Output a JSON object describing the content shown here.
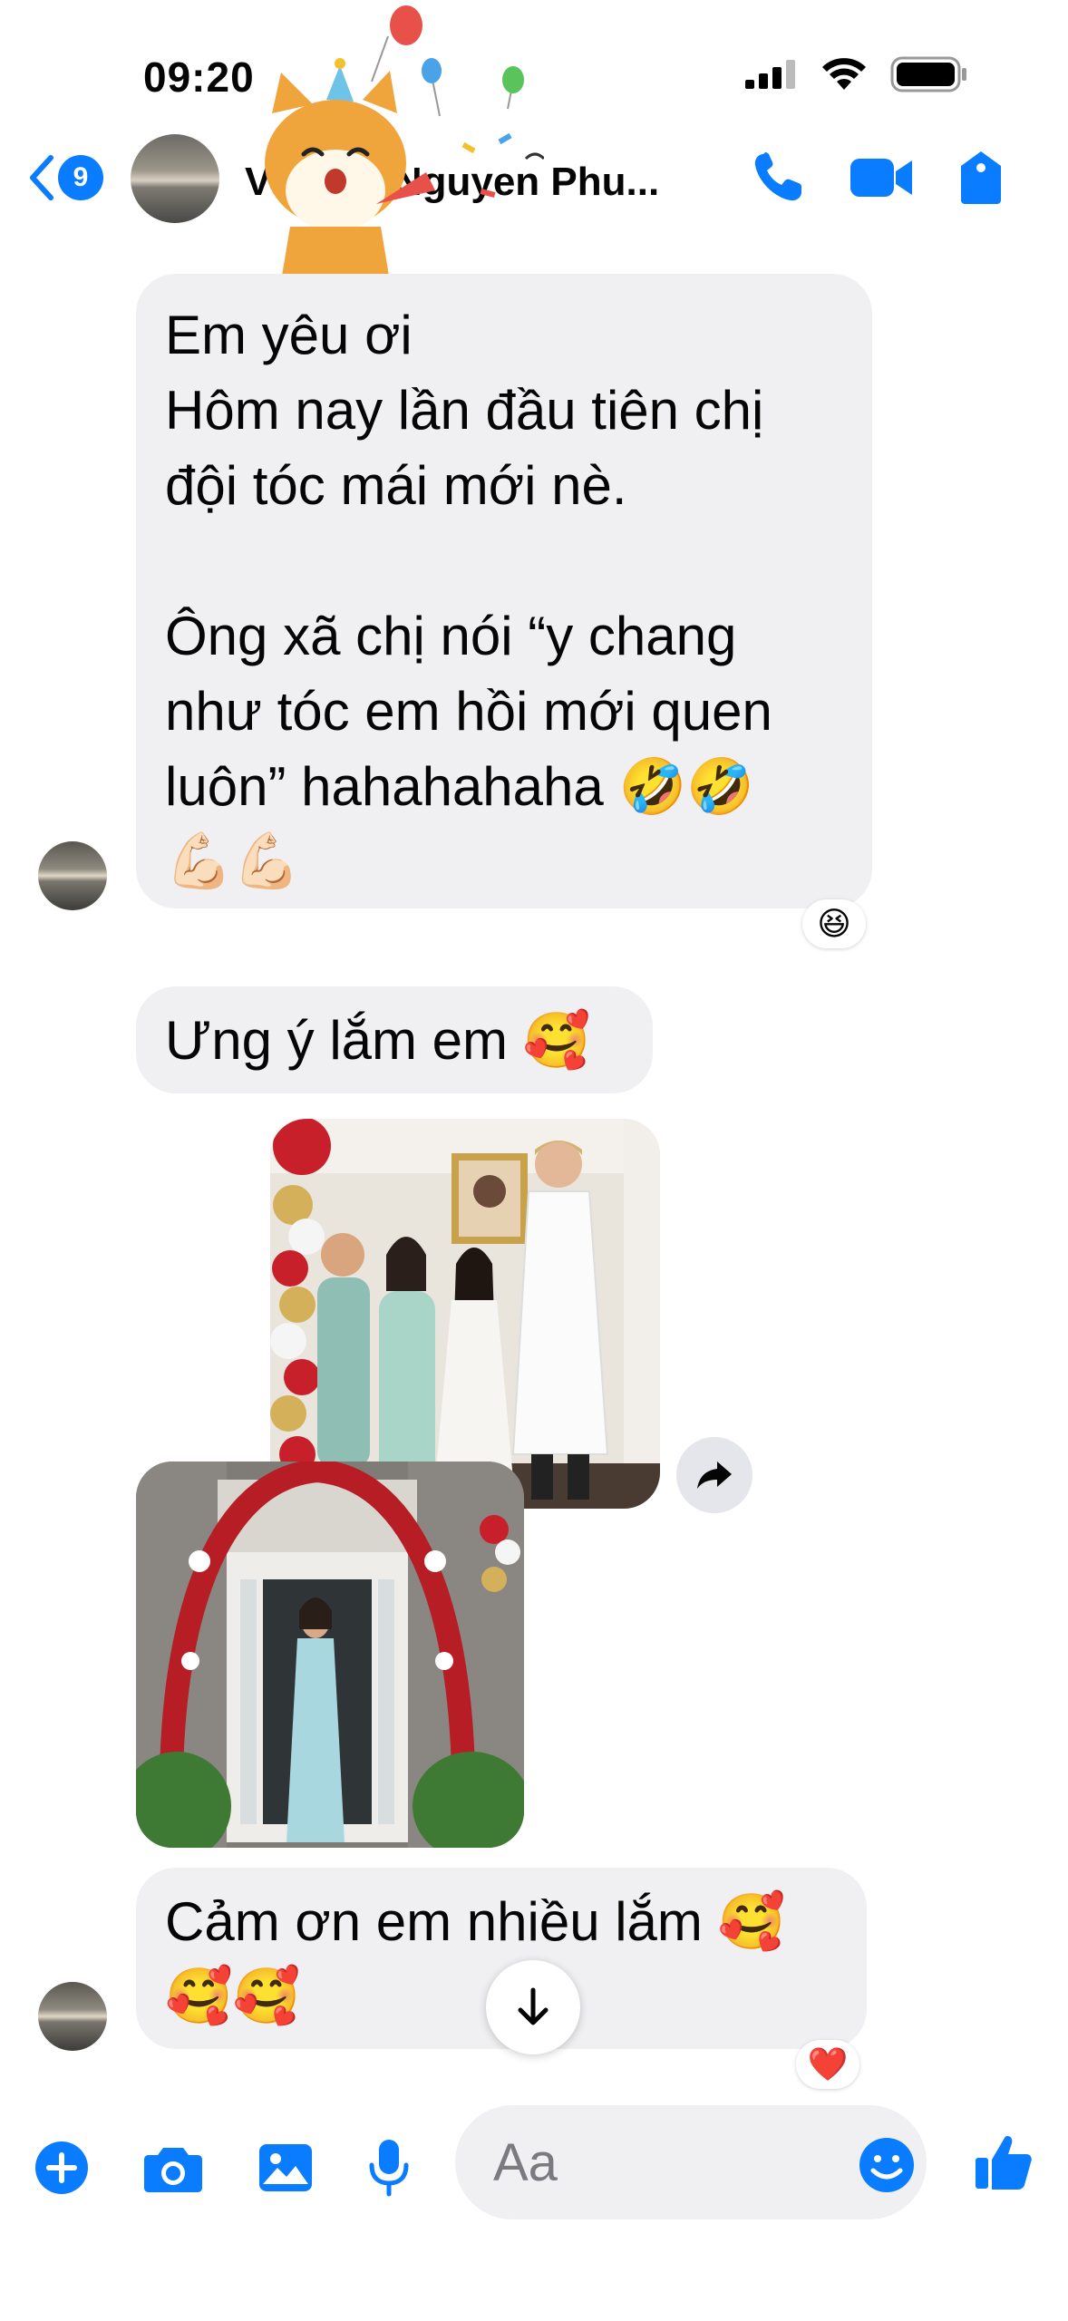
{
  "status_bar": {
    "time": "09:20"
  },
  "header": {
    "back_count": "9",
    "contact_name": "Nguyen Phu...",
    "name_prefix": "V"
  },
  "messages": [
    {
      "type": "text",
      "lines": [
        "Em yêu ơi",
        "Hôm nay lần đầu tiên chị",
        "đội tóc mái mới nè.",
        "",
        "Ông xã chị nói “y chang",
        "như tóc em hồi mới quen",
        "luôn” hahahahaha 🤣🤣",
        "💪🏻💪🏻"
      ],
      "reaction": "😆"
    },
    {
      "type": "text",
      "lines": [
        "Ưng ý lắm em 🥰"
      ]
    },
    {
      "type": "photo",
      "description_label": ""
    },
    {
      "type": "photo",
      "description_label": ""
    },
    {
      "type": "text",
      "lines": [
        "Cảm ơn em nhiều lắm 🥰",
        "🥰🥰"
      ],
      "reaction": "❤️"
    }
  ],
  "composer": {
    "placeholder": "Aa"
  },
  "colors": {
    "accent": "#0a7cff",
    "bubble": "#f0f0f3"
  },
  "icons": [
    "back-chevron-icon",
    "phone-icon",
    "video-camera-icon",
    "info-tag-icon",
    "plus-icon",
    "camera-icon",
    "image-icon",
    "microphone-icon",
    "emoji-icon",
    "thumbs-up-icon",
    "share-arrow-icon",
    "arrow-down-icon"
  ]
}
